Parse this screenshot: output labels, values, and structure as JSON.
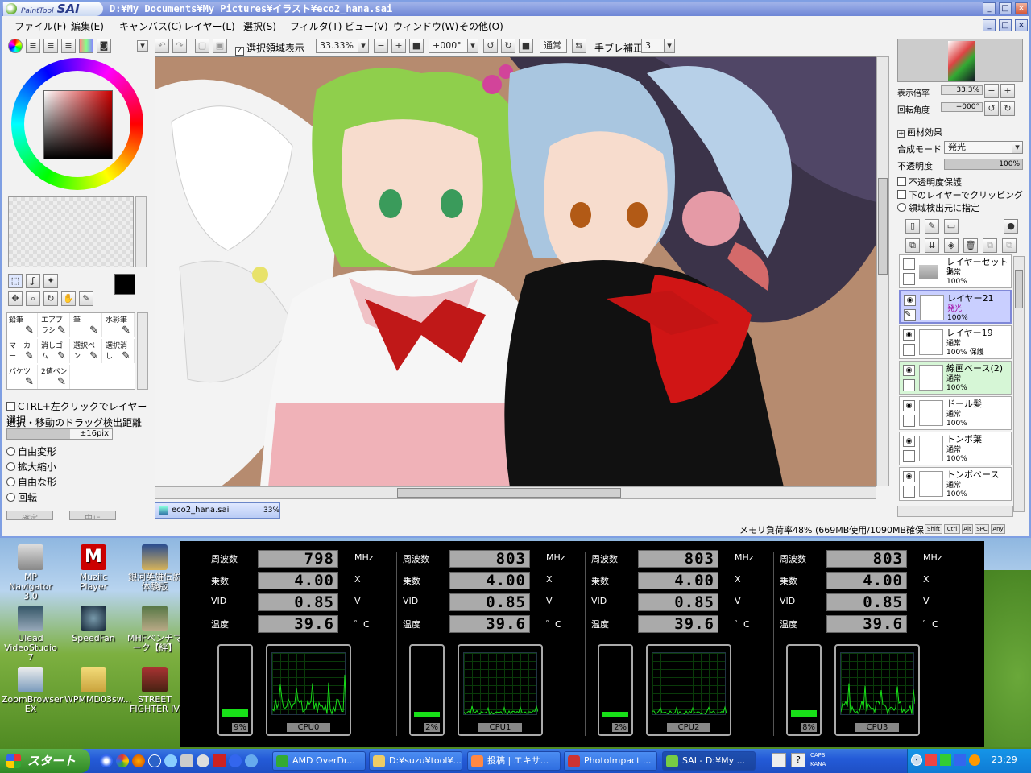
{
  "app": {
    "logo_small": "PaintTool",
    "logo_big": "SAI",
    "window_title": "D:¥My Documents¥My Pictures¥イラスト¥eco2_hana.sai"
  },
  "menu": [
    "ファイル(F)",
    "編集(E)",
    "キャンバス(C)",
    "レイヤー(L)",
    "選択(S)",
    "フィルタ(T)",
    "ビュー(V)",
    "ウィンドウ(W)",
    "その他(O)"
  ],
  "toolbar": {
    "show_selection_label": "選択領域表示",
    "zoom": "33.33%",
    "rotation": "+000°",
    "blend_mode": "通常",
    "stabilizer_label": "手ブレ補正",
    "stabilizer_value": "3"
  },
  "tools": {
    "row1": [
      "鉛筆",
      "エアブラシ",
      "筆",
      "水彩筆"
    ],
    "row2": [
      "マーカー",
      "消しゴム",
      "選択ペン",
      "選択消し"
    ],
    "row3": [
      "バケツ",
      "2値ペン"
    ]
  },
  "left_options": {
    "ctrl_select": "CTRL+左クリックでレイヤー選択",
    "drag_distance_label": "選択・移動のドラッグ検出距離",
    "drag_distance_value": "±16pix",
    "transforms": [
      "自由変形",
      "拡大縮小",
      "自由な形",
      "回転"
    ],
    "ok": "確定",
    "cancel": "中止"
  },
  "document_tab": {
    "name": "eco2_hana.sai",
    "zoom": "33%"
  },
  "status": {
    "memory": "メモリ負荷率48% (669MB使用/1090MB確保)",
    "keys": [
      "Shift",
      "Ctrl",
      "Alt",
      "SPC",
      "Any"
    ]
  },
  "navigator": {
    "zoom_label": "表示倍率",
    "zoom_value": "33.3%",
    "rotate_label": "回転角度",
    "rotate_value": "+000°"
  },
  "layer_props": {
    "texture_label": "画材効果",
    "blend_label": "合成モード",
    "blend_value": "発光",
    "opacity_label": "不透明度",
    "opacity_value": "100%",
    "protect_opacity": "不透明度保護",
    "clipping": "下のレイヤーでクリッピング",
    "selection_source": "領域検出元に指定"
  },
  "layers": [
    {
      "name": "レイヤーセット1",
      "mode": "通常",
      "opacity": "100%",
      "selected": false,
      "folder": true,
      "visible": false
    },
    {
      "name": "レイヤー21",
      "mode": "発光",
      "opacity": "100%",
      "selected": true,
      "folder": false,
      "visible": true
    },
    {
      "name": "レイヤー19",
      "mode": "通常",
      "opacity": "100% 保護",
      "selected": false,
      "folder": false,
      "visible": true
    },
    {
      "name": "線画ベース(2)",
      "mode": "通常",
      "opacity": "100%",
      "selected": false,
      "folder": false,
      "visible": true
    },
    {
      "name": "ドール髪",
      "mode": "通常",
      "opacity": "100%",
      "selected": false,
      "folder": false,
      "visible": true
    },
    {
      "name": "トンボ葉",
      "mode": "通常",
      "opacity": "100%",
      "selected": false,
      "folder": false,
      "visible": true
    },
    {
      "name": "トンボベース",
      "mode": "通常",
      "opacity": "100%",
      "selected": false,
      "folder": false,
      "visible": true
    }
  ],
  "desktop_icons": [
    "MP Navigator 3.0",
    "Muziic Player",
    "銀河英雄伝説 体験版",
    "Ulead VideoStudio 7",
    "SpeedFan",
    "MHFベンチマーク【絆】",
    "ZoomBrowser EX",
    "WPMMD03sw...",
    "STREET FIGHTER IV"
  ],
  "cpu_monitor": {
    "labels": {
      "freq": "周波数",
      "mult": "乗数",
      "vid": "VID",
      "temp": "温度"
    },
    "units": {
      "freq": "MHz",
      "mult": "X",
      "vid": "V",
      "temp": "゜C"
    },
    "cores": [
      {
        "name": "CPU0",
        "freq": "798",
        "mult": "4.00",
        "vid": "0.85",
        "temp": "39.6",
        "load": "9%",
        "load_value": 9
      },
      {
        "name": "CPU1",
        "freq": "803",
        "mult": "4.00",
        "vid": "0.85",
        "temp": "39.6",
        "load": "2%",
        "load_value": 2
      },
      {
        "name": "CPU2",
        "freq": "803",
        "mult": "4.00",
        "vid": "0.85",
        "temp": "39.6",
        "load": "2%",
        "load_value": 2
      },
      {
        "name": "CPU3",
        "freq": "803",
        "mult": "4.00",
        "vid": "0.85",
        "temp": "39.6",
        "load": "8%",
        "load_value": 8
      }
    ]
  },
  "taskbar": {
    "start": "スタート",
    "tasks": [
      "AMD OverDr...",
      "D:¥suzu¥tool¥...",
      "投稿 | エキサ...",
      "PhotoImpact ...",
      "SAI - D:¥My ..."
    ],
    "clock": "23:29",
    "ime_top": "CAPS",
    "ime_bottom": "KANA"
  }
}
